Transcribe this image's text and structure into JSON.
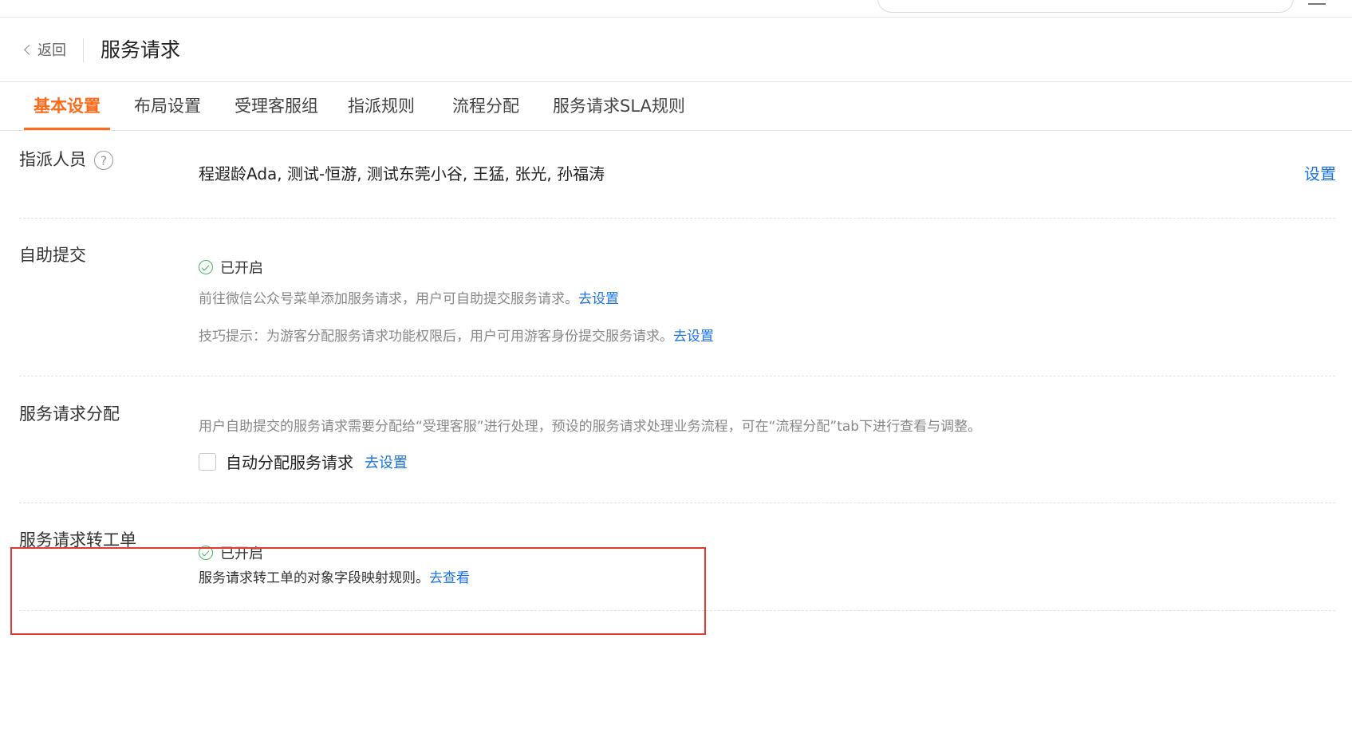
{
  "header": {
    "back_label": "返回",
    "title": "服务请求"
  },
  "tabs": [
    {
      "label": "基本设置",
      "active": true
    },
    {
      "label": "布局设置",
      "active": false
    },
    {
      "label": "受理客服组",
      "active": false
    },
    {
      "label": "指派规则",
      "active": false
    },
    {
      "label": "流程分配",
      "active": false
    },
    {
      "label": "服务请求SLA规则",
      "active": false
    }
  ],
  "assignees": {
    "label": "指派人员",
    "help_icon": "?",
    "value": "程遐龄Ada, 测试-恒游, 测试东莞小谷, 王猛, 张光, 孙福涛",
    "setting_link": "设置"
  },
  "self_submit": {
    "label": "自助提交",
    "status": "已开启",
    "hint1": "前往微信公众号菜单添加服务请求，用户可自助提交服务请求。",
    "hint1_link": "去设置",
    "hint2": "技巧提示：为游客分配服务请求功能权限后，用户可用游客身份提交服务请求。",
    "hint2_link": "去设置"
  },
  "distribution": {
    "label": "服务请求分配",
    "hint": "用户自助提交的服务请求需要分配给“受理客服”进行处理，预设的服务请求处理业务流程，可在“流程分配”tab下进行查看与调整。",
    "checkbox_label": "自动分配服务请求",
    "checkbox_checked": false,
    "link": "去设置"
  },
  "convert_ticket": {
    "label": "服务请求转工单",
    "status": "已开启",
    "hint": "服务请求转工单的对象字段映射规则。",
    "link": "去查看"
  },
  "colors": {
    "accent": "#ff6a1a",
    "link": "#1a73e8",
    "enabled": "#3fb85f",
    "highlight": "#e53935"
  }
}
